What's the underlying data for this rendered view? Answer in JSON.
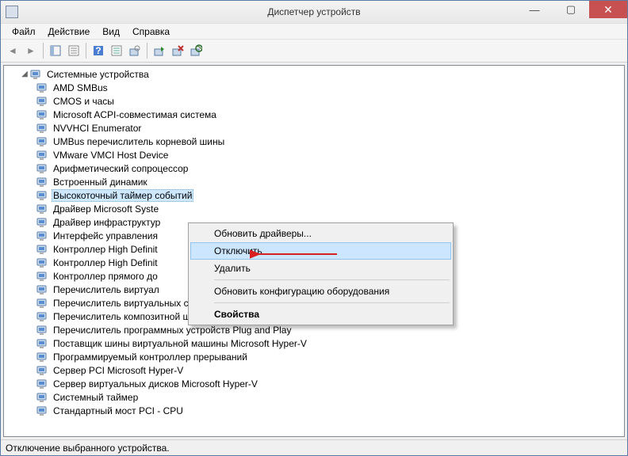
{
  "window": {
    "title": "Диспетчер устройств"
  },
  "menubar": {
    "items": [
      "Файл",
      "Действие",
      "Вид",
      "Справка"
    ]
  },
  "tree": {
    "category": "Системные устройства",
    "selected_index": 8,
    "devices": [
      "AMD SMBus",
      "CMOS и часы",
      "Microsoft ACPI-совместимая система",
      "NVVHCI Enumerator",
      "UMBus перечислитель корневой шины",
      "VMware VMCI Host Device",
      "Арифметический сопроцессор",
      "Встроенный динамик",
      "Высокоточный таймер событий",
      "Драйвер Microsoft Syste",
      "Драйвер инфраструктур",
      "Интерфейс управления ",
      "Контроллер High Definit",
      "Контроллер High Definit",
      "Контроллер прямого до",
      "Перечислитель виртуал",
      "Перечислитель виртуальных сетевых адаптеров NDIS",
      "Перечислитель композитной шины",
      "Перечислитель программных устройств Plug and Play",
      "Поставщик шины виртуальной машины Microsoft Hyper-V",
      "Программируемый контроллер прерываний",
      "Сервер PCI Microsoft Hyper-V",
      "Сервер виртуальных дисков Microsoft Hyper-V",
      "Системный таймер",
      "Стандартный мост PCI - CPU"
    ]
  },
  "context_menu": {
    "hover_index": 1,
    "items": [
      {
        "label": "Обновить драйверы...",
        "sep_after": false
      },
      {
        "label": "Отключить",
        "sep_after": false
      },
      {
        "label": "Удалить",
        "sep_after": true
      },
      {
        "label": "Обновить конфигурацию оборудования",
        "sep_after": true
      },
      {
        "label": "Свойства",
        "sep_after": false,
        "bold": true
      }
    ]
  },
  "statusbar": {
    "text": "Отключение выбранного устройства."
  },
  "icons": {
    "back": "◄",
    "fwd": "►",
    "min": "—",
    "max": "▢",
    "close": "✕",
    "help": "?"
  }
}
